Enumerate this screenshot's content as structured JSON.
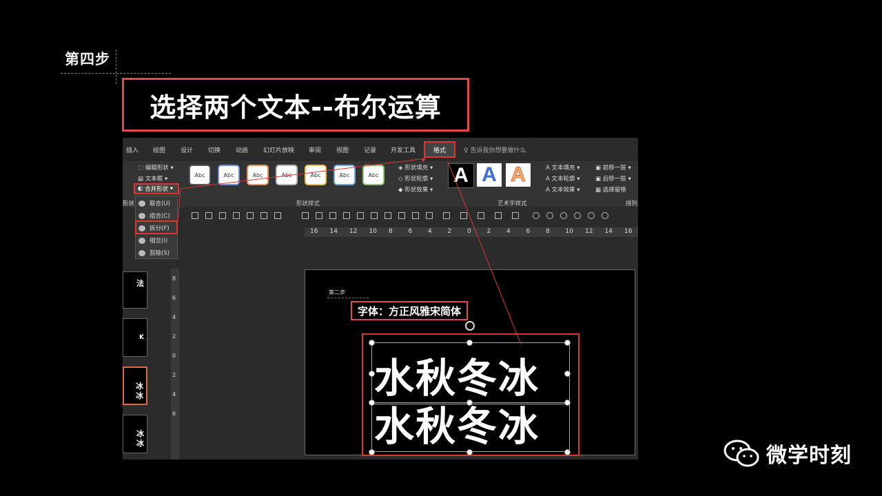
{
  "step_label": "第四步",
  "title": "选择两个文本--布尔运算",
  "tabs": [
    "插入",
    "绘图",
    "设计",
    "切换",
    "动画",
    "幻灯片放映",
    "审阅",
    "视图",
    "记录",
    "开发工具"
  ],
  "active_tab": "格式",
  "tell_me": "告诉我你想要做什么",
  "ribbon": {
    "edit_shape": "编辑形状",
    "text_box": "文本框",
    "merge_shapes": "合并形状",
    "shape_style_samples": [
      "Abc",
      "Abc",
      "Abc",
      "Abc",
      "Abc",
      "Abc",
      "Abc"
    ],
    "shape_fill": "形状填充",
    "shape_outline": "形状轮廓",
    "shape_effect": "形状效果",
    "shape_styles_group": "形状样式",
    "art_letters": [
      "A",
      "A",
      "A"
    ],
    "text_fill": "文本填充",
    "text_outline": "文本轮廓",
    "text_effect": "文本效果",
    "art_group": "艺术字样式",
    "bring_forward": "前移一层",
    "send_backward": "后移一层",
    "selection_pane": "选择窗格",
    "arrange_group": "排列",
    "shapes_group_partial": "形状"
  },
  "merge_menu": [
    "联合(U)",
    "组合(C)",
    "拆分(F)",
    "相交(I)",
    "剪除(S)"
  ],
  "ruler_h": [
    "16",
    "14",
    "12",
    "10",
    "8",
    "6",
    "4",
    "2",
    "0",
    "2",
    "4",
    "6",
    "8",
    "10",
    "12",
    "14",
    "16"
  ],
  "ruler_v": [
    "8",
    "6",
    "4",
    "2",
    "0",
    "2",
    "4",
    "6"
  ],
  "thumbs": [
    {
      "text": "法"
    },
    {
      "text": "K"
    },
    {
      "text": "冰\n冰"
    },
    {
      "text": "冰\n冰"
    }
  ],
  "slide": {
    "mini_step": "第二步",
    "font_label": "字体：方正风雅宋简体",
    "line1": "水秋冬冰",
    "line2": "水秋冬冰"
  },
  "logo_text": "微学时刻",
  "colors": {
    "accent_red": "#e03535",
    "background": "#000000",
    "ribbon": "#333333"
  }
}
